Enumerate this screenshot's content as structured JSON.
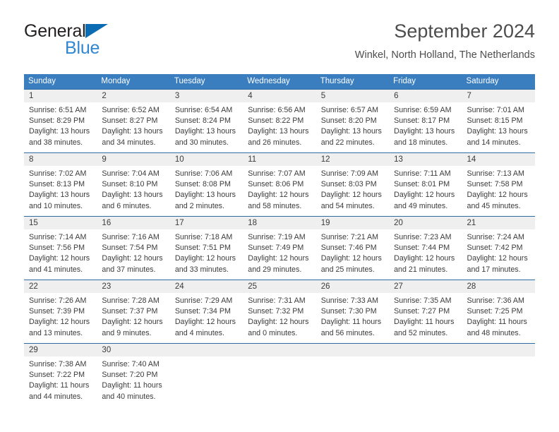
{
  "brand": {
    "name_part1": "General",
    "name_part2": "Blue",
    "accent_dark": "#231f20",
    "accent_blue": "#2f87d1",
    "triangle_blue": "#0b6cb3"
  },
  "header": {
    "title": "September 2024",
    "subtitle": "Winkel, North Holland, The Netherlands"
  },
  "calendar": {
    "header_bg": "#3a7ec0",
    "row_border": "#2e6da4",
    "band_bg": "#efefef",
    "weekdays": [
      "Sunday",
      "Monday",
      "Tuesday",
      "Wednesday",
      "Thursday",
      "Friday",
      "Saturday"
    ],
    "weeks": [
      [
        {
          "day": "1",
          "sunrise": "Sunrise: 6:51 AM",
          "sunset": "Sunset: 8:29 PM",
          "daylight_line1": "Daylight: 13 hours",
          "daylight_line2": "and 38 minutes."
        },
        {
          "day": "2",
          "sunrise": "Sunrise: 6:52 AM",
          "sunset": "Sunset: 8:27 PM",
          "daylight_line1": "Daylight: 13 hours",
          "daylight_line2": "and 34 minutes."
        },
        {
          "day": "3",
          "sunrise": "Sunrise: 6:54 AM",
          "sunset": "Sunset: 8:24 PM",
          "daylight_line1": "Daylight: 13 hours",
          "daylight_line2": "and 30 minutes."
        },
        {
          "day": "4",
          "sunrise": "Sunrise: 6:56 AM",
          "sunset": "Sunset: 8:22 PM",
          "daylight_line1": "Daylight: 13 hours",
          "daylight_line2": "and 26 minutes."
        },
        {
          "day": "5",
          "sunrise": "Sunrise: 6:57 AM",
          "sunset": "Sunset: 8:20 PM",
          "daylight_line1": "Daylight: 13 hours",
          "daylight_line2": "and 22 minutes."
        },
        {
          "day": "6",
          "sunrise": "Sunrise: 6:59 AM",
          "sunset": "Sunset: 8:17 PM",
          "daylight_line1": "Daylight: 13 hours",
          "daylight_line2": "and 18 minutes."
        },
        {
          "day": "7",
          "sunrise": "Sunrise: 7:01 AM",
          "sunset": "Sunset: 8:15 PM",
          "daylight_line1": "Daylight: 13 hours",
          "daylight_line2": "and 14 minutes."
        }
      ],
      [
        {
          "day": "8",
          "sunrise": "Sunrise: 7:02 AM",
          "sunset": "Sunset: 8:13 PM",
          "daylight_line1": "Daylight: 13 hours",
          "daylight_line2": "and 10 minutes."
        },
        {
          "day": "9",
          "sunrise": "Sunrise: 7:04 AM",
          "sunset": "Sunset: 8:10 PM",
          "daylight_line1": "Daylight: 13 hours",
          "daylight_line2": "and 6 minutes."
        },
        {
          "day": "10",
          "sunrise": "Sunrise: 7:06 AM",
          "sunset": "Sunset: 8:08 PM",
          "daylight_line1": "Daylight: 13 hours",
          "daylight_line2": "and 2 minutes."
        },
        {
          "day": "11",
          "sunrise": "Sunrise: 7:07 AM",
          "sunset": "Sunset: 8:06 PM",
          "daylight_line1": "Daylight: 12 hours",
          "daylight_line2": "and 58 minutes."
        },
        {
          "day": "12",
          "sunrise": "Sunrise: 7:09 AM",
          "sunset": "Sunset: 8:03 PM",
          "daylight_line1": "Daylight: 12 hours",
          "daylight_line2": "and 54 minutes."
        },
        {
          "day": "13",
          "sunrise": "Sunrise: 7:11 AM",
          "sunset": "Sunset: 8:01 PM",
          "daylight_line1": "Daylight: 12 hours",
          "daylight_line2": "and 49 minutes."
        },
        {
          "day": "14",
          "sunrise": "Sunrise: 7:13 AM",
          "sunset": "Sunset: 7:58 PM",
          "daylight_line1": "Daylight: 12 hours",
          "daylight_line2": "and 45 minutes."
        }
      ],
      [
        {
          "day": "15",
          "sunrise": "Sunrise: 7:14 AM",
          "sunset": "Sunset: 7:56 PM",
          "daylight_line1": "Daylight: 12 hours",
          "daylight_line2": "and 41 minutes."
        },
        {
          "day": "16",
          "sunrise": "Sunrise: 7:16 AM",
          "sunset": "Sunset: 7:54 PM",
          "daylight_line1": "Daylight: 12 hours",
          "daylight_line2": "and 37 minutes."
        },
        {
          "day": "17",
          "sunrise": "Sunrise: 7:18 AM",
          "sunset": "Sunset: 7:51 PM",
          "daylight_line1": "Daylight: 12 hours",
          "daylight_line2": "and 33 minutes."
        },
        {
          "day": "18",
          "sunrise": "Sunrise: 7:19 AM",
          "sunset": "Sunset: 7:49 PM",
          "daylight_line1": "Daylight: 12 hours",
          "daylight_line2": "and 29 minutes."
        },
        {
          "day": "19",
          "sunrise": "Sunrise: 7:21 AM",
          "sunset": "Sunset: 7:46 PM",
          "daylight_line1": "Daylight: 12 hours",
          "daylight_line2": "and 25 minutes."
        },
        {
          "day": "20",
          "sunrise": "Sunrise: 7:23 AM",
          "sunset": "Sunset: 7:44 PM",
          "daylight_line1": "Daylight: 12 hours",
          "daylight_line2": "and 21 minutes."
        },
        {
          "day": "21",
          "sunrise": "Sunrise: 7:24 AM",
          "sunset": "Sunset: 7:42 PM",
          "daylight_line1": "Daylight: 12 hours",
          "daylight_line2": "and 17 minutes."
        }
      ],
      [
        {
          "day": "22",
          "sunrise": "Sunrise: 7:26 AM",
          "sunset": "Sunset: 7:39 PM",
          "daylight_line1": "Daylight: 12 hours",
          "daylight_line2": "and 13 minutes."
        },
        {
          "day": "23",
          "sunrise": "Sunrise: 7:28 AM",
          "sunset": "Sunset: 7:37 PM",
          "daylight_line1": "Daylight: 12 hours",
          "daylight_line2": "and 9 minutes."
        },
        {
          "day": "24",
          "sunrise": "Sunrise: 7:29 AM",
          "sunset": "Sunset: 7:34 PM",
          "daylight_line1": "Daylight: 12 hours",
          "daylight_line2": "and 4 minutes."
        },
        {
          "day": "25",
          "sunrise": "Sunrise: 7:31 AM",
          "sunset": "Sunset: 7:32 PM",
          "daylight_line1": "Daylight: 12 hours",
          "daylight_line2": "and 0 minutes."
        },
        {
          "day": "26",
          "sunrise": "Sunrise: 7:33 AM",
          "sunset": "Sunset: 7:30 PM",
          "daylight_line1": "Daylight: 11 hours",
          "daylight_line2": "and 56 minutes."
        },
        {
          "day": "27",
          "sunrise": "Sunrise: 7:35 AM",
          "sunset": "Sunset: 7:27 PM",
          "daylight_line1": "Daylight: 11 hours",
          "daylight_line2": "and 52 minutes."
        },
        {
          "day": "28",
          "sunrise": "Sunrise: 7:36 AM",
          "sunset": "Sunset: 7:25 PM",
          "daylight_line1": "Daylight: 11 hours",
          "daylight_line2": "and 48 minutes."
        }
      ],
      [
        {
          "day": "29",
          "sunrise": "Sunrise: 7:38 AM",
          "sunset": "Sunset: 7:22 PM",
          "daylight_line1": "Daylight: 11 hours",
          "daylight_line2": "and 44 minutes."
        },
        {
          "day": "30",
          "sunrise": "Sunrise: 7:40 AM",
          "sunset": "Sunset: 7:20 PM",
          "daylight_line1": "Daylight: 11 hours",
          "daylight_line2": "and 40 minutes."
        },
        {
          "day": "",
          "sunrise": "",
          "sunset": "",
          "daylight_line1": "",
          "daylight_line2": ""
        },
        {
          "day": "",
          "sunrise": "",
          "sunset": "",
          "daylight_line1": "",
          "daylight_line2": ""
        },
        {
          "day": "",
          "sunrise": "",
          "sunset": "",
          "daylight_line1": "",
          "daylight_line2": ""
        },
        {
          "day": "",
          "sunrise": "",
          "sunset": "",
          "daylight_line1": "",
          "daylight_line2": ""
        },
        {
          "day": "",
          "sunrise": "",
          "sunset": "",
          "daylight_line1": "",
          "daylight_line2": ""
        }
      ]
    ]
  }
}
